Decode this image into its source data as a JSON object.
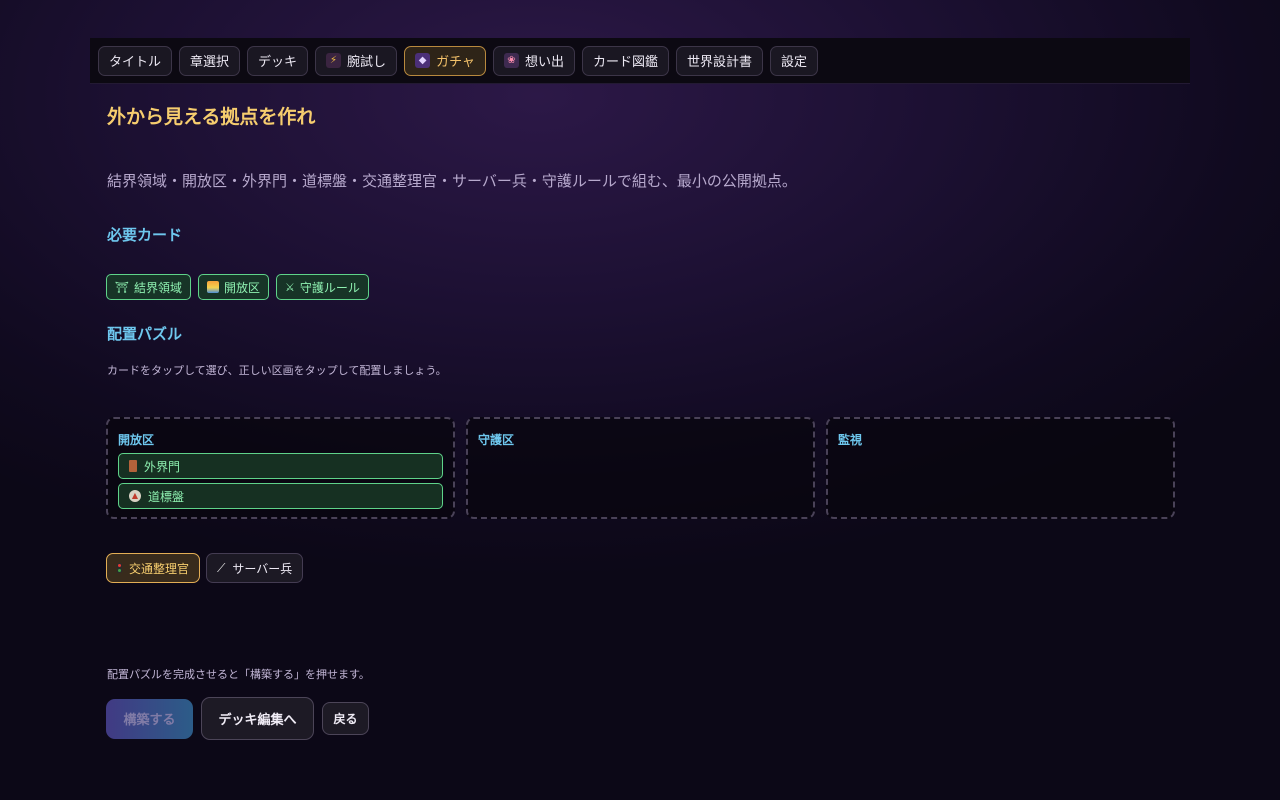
{
  "nav": {
    "items": [
      {
        "label": "タイトル"
      },
      {
        "label": "章選択"
      },
      {
        "label": "デッキ"
      },
      {
        "label": "腕試し",
        "icon": "lightning-icon"
      },
      {
        "label": "ガチャ",
        "icon": "gacha-icon",
        "active": true
      },
      {
        "label": "想い出",
        "icon": "memory-icon"
      },
      {
        "label": "カード図鑑"
      },
      {
        "label": "世界設計書"
      },
      {
        "label": "設定"
      }
    ]
  },
  "page": {
    "title": "外から見える拠点を作れ",
    "description": "結界領域・開放区・外界門・道標盤・交通整理官・サーバー兵・守護ルールで組む、最小の公開拠点。"
  },
  "required": {
    "heading": "必要カード",
    "cards": [
      {
        "label": "結界領域",
        "icon": "torii-icon",
        "glyph": "⛩"
      },
      {
        "label": "開放区",
        "icon": "sunrise-icon"
      },
      {
        "label": "守護ルール",
        "icon": "crossed-swords-icon",
        "glyph": "⚔"
      }
    ]
  },
  "puzzle": {
    "heading": "配置パズル",
    "hint": "カードをタップして選び、正しい区画をタップして配置しましょう。",
    "zones": [
      {
        "label": "開放区",
        "cards": [
          {
            "label": "外界門",
            "icon": "door-icon"
          },
          {
            "label": "道標盤",
            "icon": "compass-icon"
          }
        ]
      },
      {
        "label": "守護区",
        "cards": []
      },
      {
        "label": "監視",
        "cards": []
      }
    ],
    "hand": [
      {
        "label": "交通整理官",
        "icon": "traffic-light-icon",
        "selected": true
      },
      {
        "label": "サーバー兵",
        "icon": "sword-icon",
        "selected": false
      }
    ]
  },
  "footer": {
    "hint": "配置パズルを完成させると「構築する」を押せます。",
    "build_label": "構築する",
    "deck_label": "デッキ編集へ",
    "back_label": "戻る"
  },
  "colors": {
    "accent_gold": "#f6cd6e",
    "accent_cyan": "#6ec7ee",
    "accent_green": "#8ef0b0"
  }
}
